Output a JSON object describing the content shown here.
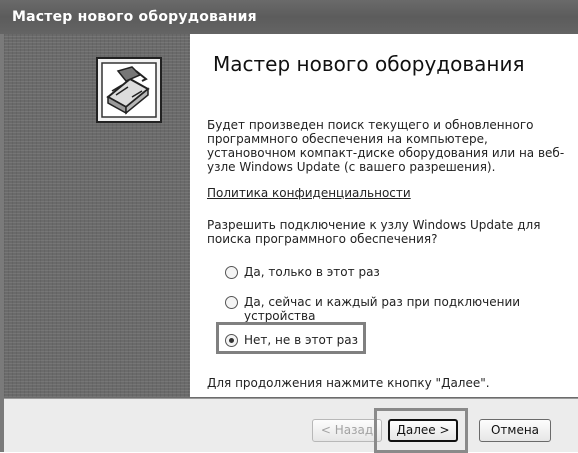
{
  "window": {
    "title": "Мастер нового оборудования"
  },
  "side": {
    "icon": "hardware-install-icon"
  },
  "main": {
    "heading": "Мастер нового оборудования",
    "description": "Будет произведен поиск текущего и обновленного программного обеспечения на компьютере, установочном компакт-диске оборудования или на веб-узле Windows Update (с вашего разрешения).",
    "privacy_link": "Политика конфиденциальности",
    "question": "Разрешить подключение к узлу Windows Update для поиска программного обеспечения?",
    "options": [
      {
        "label": "Да, только в этот раз",
        "selected": false
      },
      {
        "label": "Да, сейчас и каждый раз при подключении устройства",
        "selected": false
      },
      {
        "label": "Нет, не в этот раз",
        "selected": true
      }
    ],
    "continue_text": "Для продолжения нажмите кнопку \"Далее\"."
  },
  "buttons": {
    "back": "< Назад",
    "next": "Далее >",
    "cancel": "Отмена"
  }
}
